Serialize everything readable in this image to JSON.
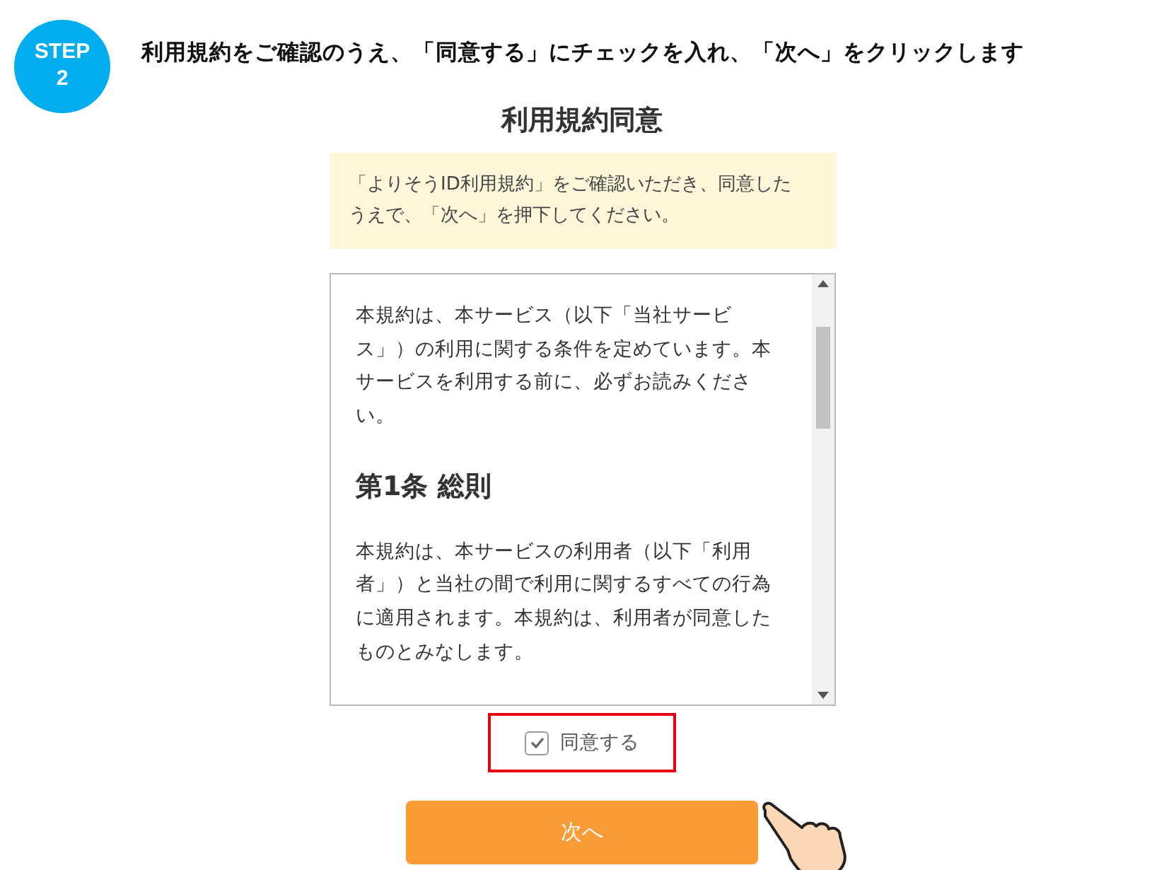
{
  "step": {
    "label": "STEP",
    "number": "2"
  },
  "instruction": "利用規約をご確認のうえ、「同意する」にチェックを入れ、「次へ」をクリックします",
  "title": "利用規約同意",
  "notice": "「よりそうID利用規約」をご確認いただき、同意したうえで、「次へ」を押下してください。",
  "terms": [
    {
      "kind": "paragraph",
      "text": "本規約は、本サービス（以下「当社サービス」）の利用に関する条件を定めています。本サービスを利用する前に、必ずお読みください。"
    },
    {
      "kind": "heading",
      "text": "第1条 総則"
    },
    {
      "kind": "paragraph",
      "text": "本規約は、本サービスの利用者（以下「利用者」）と当社の間で利用に関するすべての行為に適用されます。本規約は、利用者が同意したものとみなします。"
    }
  ],
  "agree": {
    "label": "同意する",
    "checked": true,
    "highlighted": true
  },
  "next_button": {
    "label": "次へ"
  }
}
